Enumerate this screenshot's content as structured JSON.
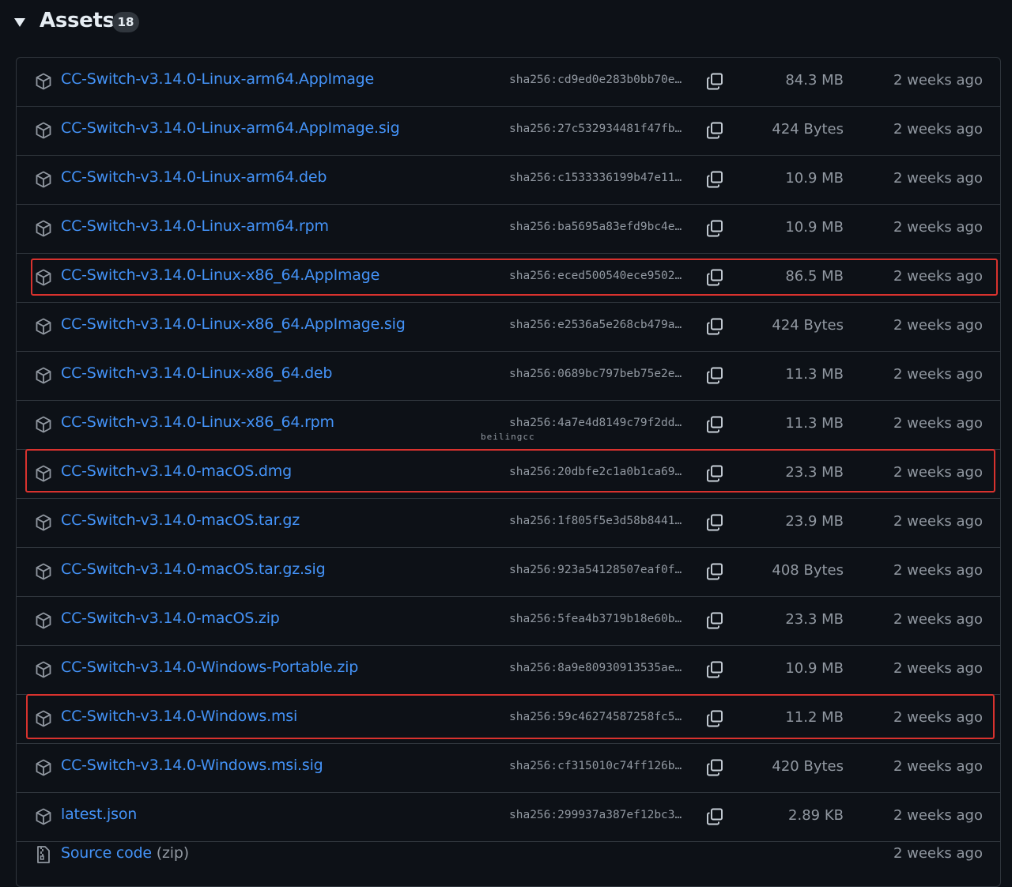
{
  "header": {
    "title": "Assets",
    "count": "18",
    "toggle_icon": "triangle-down-icon"
  },
  "assets": [
    {
      "name": "CC-Switch-v3.14.0-Linux-arm64.AppImage",
      "sha": "sha256:cd9ed0e283b0bb70e…",
      "size": "84.3 MB",
      "date": "2 weeks ago",
      "highlighted": false
    },
    {
      "name": "CC-Switch-v3.14.0-Linux-arm64.AppImage.sig",
      "sha": "sha256:27c532934481f47fb…",
      "size": "424 Bytes",
      "date": "2 weeks ago",
      "highlighted": false
    },
    {
      "name": "CC-Switch-v3.14.0-Linux-arm64.deb",
      "sha": "sha256:c1533336199b47e11…",
      "size": "10.9 MB",
      "date": "2 weeks ago",
      "highlighted": false
    },
    {
      "name": "CC-Switch-v3.14.0-Linux-arm64.rpm",
      "sha": "sha256:ba5695a83efd9bc4e…",
      "size": "10.9 MB",
      "date": "2 weeks ago",
      "highlighted": false
    },
    {
      "name": "CC-Switch-v3.14.0-Linux-x86_64.AppImage",
      "sha": "sha256:eced500540ece9502…",
      "size": "86.5 MB",
      "date": "2 weeks ago",
      "highlighted": true
    },
    {
      "name": "CC-Switch-v3.14.0-Linux-x86_64.AppImage.sig",
      "sha": "sha256:e2536a5e268cb479a…",
      "size": "424 Bytes",
      "date": "2 weeks ago",
      "highlighted": false
    },
    {
      "name": "CC-Switch-v3.14.0-Linux-x86_64.deb",
      "sha": "sha256:0689bc797beb75e2e…",
      "size": "11.3 MB",
      "date": "2 weeks ago",
      "highlighted": false
    },
    {
      "name": "CC-Switch-v3.14.0-Linux-x86_64.rpm",
      "sha": "sha256:4a7e4d8149c79f2dd…",
      "size": "11.3 MB",
      "date": "2 weeks ago",
      "highlighted": false
    },
    {
      "name": "CC-Switch-v3.14.0-macOS.dmg",
      "sha": "sha256:20dbfe2c1a0b1ca69…",
      "size": "23.3 MB",
      "date": "2 weeks ago",
      "highlighted": true
    },
    {
      "name": "CC-Switch-v3.14.0-macOS.tar.gz",
      "sha": "sha256:1f805f5e3d58b8441…",
      "size": "23.9 MB",
      "date": "2 weeks ago",
      "highlighted": false
    },
    {
      "name": "CC-Switch-v3.14.0-macOS.tar.gz.sig",
      "sha": "sha256:923a54128507eaf0f…",
      "size": "408 Bytes",
      "date": "2 weeks ago",
      "highlighted": false
    },
    {
      "name": "CC-Switch-v3.14.0-macOS.zip",
      "sha": "sha256:5fea4b3719b18e60b…",
      "size": "23.3 MB",
      "date": "2 weeks ago",
      "highlighted": false
    },
    {
      "name": "CC-Switch-v3.14.0-Windows-Portable.zip",
      "sha": "sha256:8a9e80930913535ae…",
      "size": "10.9 MB",
      "date": "2 weeks ago",
      "highlighted": false
    },
    {
      "name": "CC-Switch-v3.14.0-Windows.msi",
      "sha": "sha256:59c46274587258fc5…",
      "size": "11.2 MB",
      "date": "2 weeks ago",
      "highlighted": true
    },
    {
      "name": "CC-Switch-v3.14.0-Windows.msi.sig",
      "sha": "sha256:cf315010c74ff126b…",
      "size": "420 Bytes",
      "date": "2 weeks ago",
      "highlighted": false
    },
    {
      "name": "latest.json",
      "sha": "sha256:299937a387ef12bc3…",
      "size": "2.89 KB",
      "date": "2 weeks ago",
      "highlighted": false
    }
  ],
  "source_code": {
    "label": "Source code",
    "suffix": "(zip)",
    "date": "2 weeks ago"
  },
  "watermark": "beilingcc",
  "colors": {
    "link": "#4493f8",
    "muted": "#9198a1",
    "border": "#30363d",
    "background": "#0d1117",
    "highlight": "#d8322e"
  },
  "icons": {
    "asset": "package-icon",
    "copy": "copy-icon",
    "source": "file-zip-icon"
  }
}
